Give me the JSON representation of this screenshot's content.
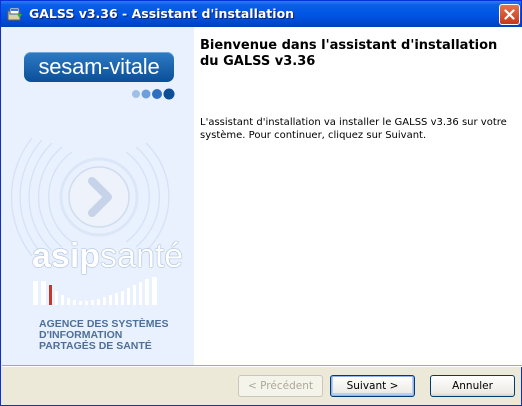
{
  "window": {
    "title": "GALSS v3.36 - Assistant d'installation",
    "icon": "installer-icon",
    "close_icon": "close-icon"
  },
  "sidebar": {
    "brand_logo_text": "sesam-vitale",
    "partner_logo": {
      "name_bold": "asip",
      "name_regular": "santé"
    },
    "agency_lines": [
      "AGENCE DES SYSTÈMES",
      "D'INFORMATION",
      "PARTAGÉS DE SANTÉ"
    ],
    "colors": {
      "panel": "#e9f1ff",
      "logo_blue": "#0a4f98",
      "agency_text": "#4e6f97"
    }
  },
  "main": {
    "heading": "Bienvenue dans l'assistant d'installation du GALSS v3.36",
    "body": "L'assistant d'installation va installer le GALSS v3.36 sur votre système. Pour continuer, cliquez sur Suivant."
  },
  "buttons": {
    "back_label": "< Précédent",
    "next_label": "Suivant >",
    "cancel_label": "Annuler"
  }
}
